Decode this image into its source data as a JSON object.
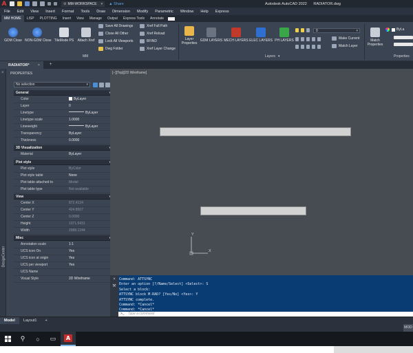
{
  "app": {
    "logo": "A",
    "workspace": "MM-WORKSPACE",
    "share": "Share",
    "product": "Autodesk AutoCAD 2022",
    "file": "RADIATOR.dwg"
  },
  "menu": [
    "File",
    "Edit",
    "View",
    "Insert",
    "Format",
    "Tools",
    "Draw",
    "Dimension",
    "Modify",
    "Parametric",
    "Window",
    "Help",
    "Express"
  ],
  "ribbon_tabs": [
    "MM HOME",
    "LISP",
    "PLOTTING",
    "Insert",
    "View",
    "Manage",
    "Output",
    "Express Tools",
    "Annotate"
  ],
  "ribbon": {
    "big_buttons": [
      {
        "label": "GDM Close",
        "icon": "globe-icon",
        "color": "#3a7bd5"
      },
      {
        "label": "NON-GDM Close",
        "icon": "globe-icon",
        "color": "#3a7bd5"
      },
      {
        "label": "TileMode PS",
        "icon": "tile-icon",
        "color": "#d0d4da"
      },
      {
        "label": "Attach Xref",
        "icon": "xref-icon",
        "color": "#d0d4da"
      }
    ],
    "small_col1": [
      "Save All Drawings",
      "Close All Other",
      "Lock All Viewports",
      "Dwg Folder"
    ],
    "small_col2": [
      "Xref Full Path",
      "Xref Reload",
      "BFIND",
      "Xref Layer Change"
    ],
    "panel_mm": "MM",
    "layer_props": "Layer Properties",
    "layer_buttons": [
      "GDM LAYERS",
      "MECH LAYERS",
      "ELEC LAYERS",
      "PH LAYERS"
    ],
    "layer_value": "0",
    "make_current": "Make Current",
    "match_layer": "Match Layer",
    "panel_layers": "Layers",
    "match_props": "Match Properties",
    "panel_properties": "Properties",
    "bylayer": "ByLa"
  },
  "file_tab": "RADIATOR*",
  "left_strip": "DesignCenter",
  "properties": {
    "title": "PROPERTIES",
    "selection": "No selection",
    "sections": [
      {
        "name": "General",
        "rows": [
          {
            "k": "Color",
            "v": "ByLayer"
          },
          {
            "k": "Layer",
            "v": "0"
          },
          {
            "k": "Linetype",
            "v": "ByLayer"
          },
          {
            "k": "Linetype scale",
            "v": "1.0000"
          },
          {
            "k": "Lineweight",
            "v": "ByLayer"
          },
          {
            "k": "Transparency",
            "v": "ByLayer"
          },
          {
            "k": "Thickness",
            "v": "0.0000"
          }
        ]
      },
      {
        "name": "3D Visualization",
        "rows": [
          {
            "k": "Material",
            "v": "ByLayer"
          }
        ]
      },
      {
        "name": "Plot style",
        "rows": [
          {
            "k": "Plot style",
            "v": "ByColor"
          },
          {
            "k": "Plot style table",
            "v": "None"
          },
          {
            "k": "Plot table attached to",
            "v": "Model"
          },
          {
            "k": "Plot table type",
            "v": "Not available"
          }
        ]
      },
      {
        "name": "View",
        "rows": [
          {
            "k": "Center X",
            "v": "872.4124"
          },
          {
            "k": "Center Y",
            "v": "424.8507"
          },
          {
            "k": "Center Z",
            "v": "0.0000"
          },
          {
            "k": "Height",
            "v": "1071.5431"
          },
          {
            "k": "Width",
            "v": "2988.1244"
          }
        ]
      },
      {
        "name": "Misc",
        "rows": [
          {
            "k": "Annotation scale",
            "v": "1:1"
          },
          {
            "k": "UCS icon On",
            "v": "Yes"
          },
          {
            "k": "UCS icon at origin",
            "v": "Yes"
          },
          {
            "k": "UCS per viewport",
            "v": "Yes"
          },
          {
            "k": "UCS Name",
            "v": ""
          },
          {
            "k": "Visual Style",
            "v": "2D Wireframe"
          }
        ]
      }
    ]
  },
  "viewport_label": "[−][Top][2D Wireframe]",
  "ucs": {
    "x": "X",
    "y": "Y"
  },
  "command": {
    "lines": [
      "Command: ATTSYNC",
      "Enter an option [?/Name/Select] <Select>: S",
      "Select a block:",
      "ATTSYNC block M-RAD? [Yes/No] <Yes>: Y",
      "ATTSYNC complete.",
      "Command: *Cancel*",
      "Command: *Cancel*"
    ],
    "placeholder": "Type a command",
    "prompt": ">_"
  },
  "layout_tabs": [
    "Model",
    "Layout1"
  ],
  "add_layout": "+",
  "status_model": "MOD",
  "taskbar": {
    "acad": "A"
  }
}
